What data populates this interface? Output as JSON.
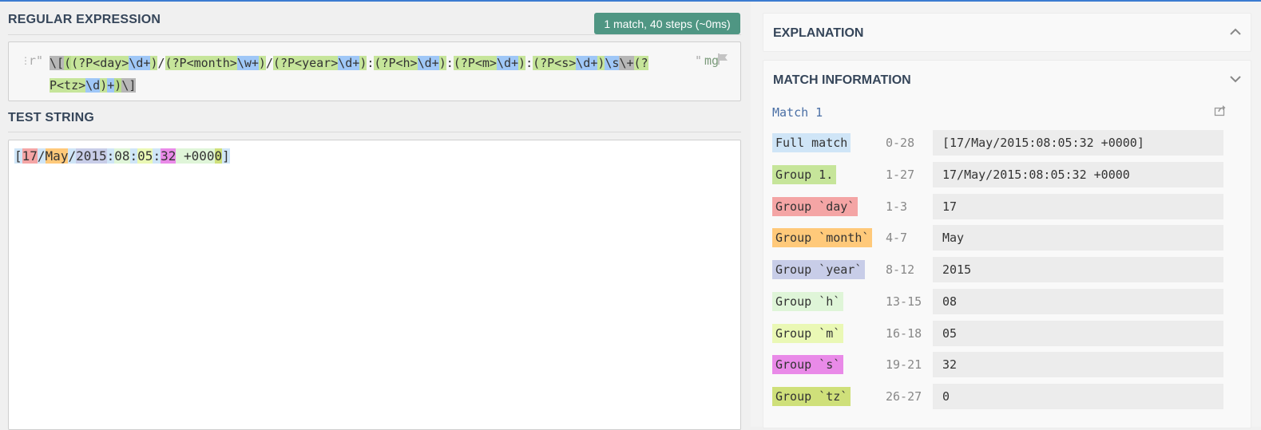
{
  "regex_section": {
    "title": "REGULAR EXPRESSION",
    "badge": "1 match, 40 steps (~0ms)",
    "open_delim": "r\"",
    "close_delim": "\"",
    "flags": "mg",
    "tokens": [
      {
        "t": "\\[",
        "c": "t-gray"
      },
      {
        "t": "(",
        "c": "t-grp"
      },
      {
        "t": "(?P<day>",
        "c": "t-grp2"
      },
      {
        "t": "\\d+",
        "c": "t-esc"
      },
      {
        "t": ")",
        "c": "t-grp2"
      },
      {
        "t": "/",
        "c": ""
      },
      {
        "t": "(?P<month>",
        "c": "t-grp2"
      },
      {
        "t": "\\w+",
        "c": "t-esc"
      },
      {
        "t": ")",
        "c": "t-grp2"
      },
      {
        "t": "/",
        "c": ""
      },
      {
        "t": "(?P<year>",
        "c": "t-grp2"
      },
      {
        "t": "\\d+",
        "c": "t-esc"
      },
      {
        "t": ")",
        "c": "t-grp2"
      },
      {
        "t": ":",
        "c": ""
      },
      {
        "t": "(?P<h>",
        "c": "t-grp2"
      },
      {
        "t": "\\d+",
        "c": "t-esc"
      },
      {
        "t": ")",
        "c": "t-grp2"
      },
      {
        "t": ":",
        "c": ""
      },
      {
        "t": "(?P<m>",
        "c": "t-grp2"
      },
      {
        "t": "\\d+",
        "c": "t-esc"
      },
      {
        "t": ")",
        "c": "t-grp2"
      },
      {
        "t": ":",
        "c": ""
      },
      {
        "t": "(?P<s>",
        "c": "t-grp2"
      },
      {
        "t": "\\d+",
        "c": "t-esc"
      },
      {
        "t": ")",
        "c": "t-grp2"
      },
      {
        "t": "\\s",
        "c": "t-esc"
      },
      {
        "t": "\\+",
        "c": "t-gray"
      },
      {
        "t": "(?P<tz>",
        "c": "t-grp2"
      },
      {
        "t": "\\d",
        "c": "t-esc"
      },
      {
        "t": ")",
        "c": "t-grp2"
      },
      {
        "t": "+",
        "c": "t-esc"
      },
      {
        "t": ")",
        "c": "t-grp"
      },
      {
        "t": "\\]",
        "c": "t-gray"
      }
    ]
  },
  "test_section": {
    "title": "TEST STRING",
    "segments": [
      {
        "t": "[",
        "c": "hl-full"
      },
      {
        "t": "17",
        "c": "hl-day"
      },
      {
        "t": "/",
        "c": "hl-sep"
      },
      {
        "t": "May",
        "c": "hl-month"
      },
      {
        "t": "/",
        "c": "hl-sep"
      },
      {
        "t": "2015",
        "c": "hl-year"
      },
      {
        "t": ":",
        "c": "hl-sep"
      },
      {
        "t": "08",
        "c": "hl-h"
      },
      {
        "t": ":",
        "c": "hl-sep"
      },
      {
        "t": "05",
        "c": "hl-m"
      },
      {
        "t": ":",
        "c": "hl-sep"
      },
      {
        "t": "32",
        "c": "hl-s"
      },
      {
        "t": " +000",
        "c": "hl-h"
      },
      {
        "t": "0",
        "c": "hl-tz"
      },
      {
        "t": "]",
        "c": "hl-full"
      }
    ]
  },
  "explanation": {
    "title": "EXPLANATION"
  },
  "match_info": {
    "title": "MATCH INFORMATION",
    "match_label": "Match 1",
    "rows": [
      {
        "name": "Full match",
        "range": "0-28",
        "value": "[17/May/2015:08:05:32 +0000]",
        "color": "#cfe5f7"
      },
      {
        "name": "Group 1.",
        "range": "1-27",
        "value": "17/May/2015:08:05:32 +0000",
        "color": "#c6e59a"
      },
      {
        "name": "Group `day`",
        "range": "1-3",
        "value": "17",
        "color": "#f4a5a5"
      },
      {
        "name": "Group `month`",
        "range": "4-7",
        "value": "May",
        "color": "#ffc97a"
      },
      {
        "name": "Group `year`",
        "range": "8-12",
        "value": "2015",
        "color": "#c8cde8"
      },
      {
        "name": "Group `h`",
        "range": "13-15",
        "value": "08",
        "color": "#dff5d8"
      },
      {
        "name": "Group `m`",
        "range": "16-18",
        "value": "05",
        "color": "#eaf8b5"
      },
      {
        "name": "Group `s`",
        "range": "19-21",
        "value": "32",
        "color": "#e98ae8"
      },
      {
        "name": "Group `tz`",
        "range": "26-27",
        "value": "0",
        "color": "#cfe07a"
      }
    ]
  }
}
